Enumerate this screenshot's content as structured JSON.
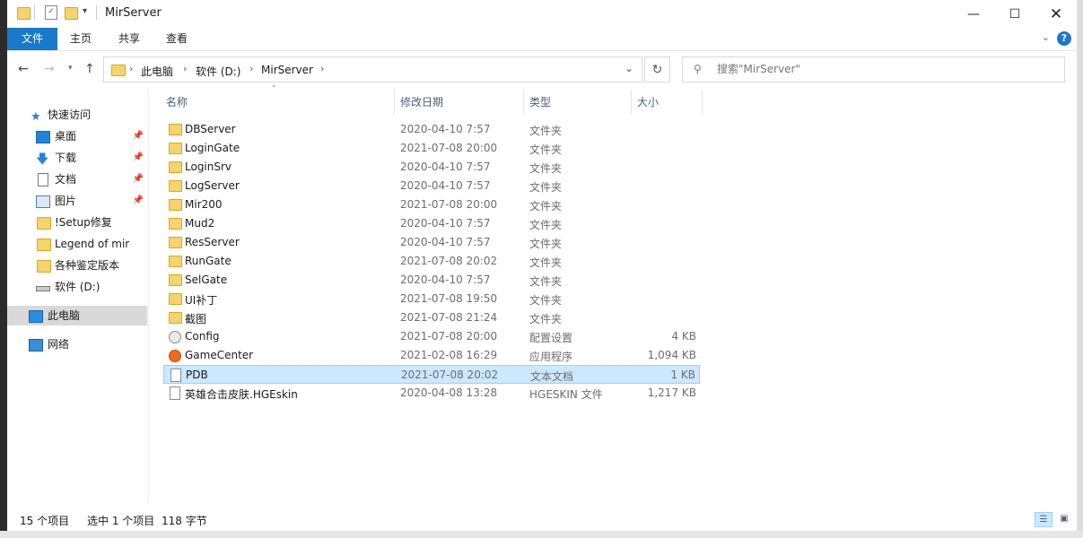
{
  "window": {
    "title": "MirServer"
  },
  "ribbon": {
    "tabs": [
      "文件",
      "主页",
      "共享",
      "查看"
    ],
    "help": "?"
  },
  "nav": {
    "address": [
      "此电脑",
      "软件 (D:)",
      "MirServer"
    ],
    "search_placeholder": "搜索\"MirServer\""
  },
  "sidebar": {
    "items": [
      {
        "label": "快速访问",
        "icon": "star-icon"
      },
      {
        "label": "桌面",
        "icon": "desktop-icon",
        "pinned": true
      },
      {
        "label": "下载",
        "icon": "download-icon",
        "pinned": true
      },
      {
        "label": "文档",
        "icon": "document-icon",
        "pinned": true
      },
      {
        "label": "图片",
        "icon": "picture-icon",
        "pinned": true
      },
      {
        "label": "!Setup修复",
        "icon": "folder-icon"
      },
      {
        "label": "Legend of mir",
        "icon": "folder-icon"
      },
      {
        "label": "各种鉴定版本",
        "icon": "folder-icon"
      },
      {
        "label": "软件 (D:)",
        "icon": "drive-icon"
      },
      {
        "label": "此电脑",
        "icon": "computer-icon"
      },
      {
        "label": "网络",
        "icon": "network-icon"
      }
    ]
  },
  "columns": {
    "name": "名称",
    "date": "修改日期",
    "type": "类型",
    "size": "大小"
  },
  "files": [
    {
      "name": "DBServer",
      "date": "2020-04-10 7:57",
      "type": "文件夹",
      "size": "",
      "icon": "folder-icon"
    },
    {
      "name": "LoginGate",
      "date": "2021-07-08 20:00",
      "type": "文件夹",
      "size": "",
      "icon": "folder-icon"
    },
    {
      "name": "LoginSrv",
      "date": "2020-04-10 7:57",
      "type": "文件夹",
      "size": "",
      "icon": "folder-icon"
    },
    {
      "name": "LogServer",
      "date": "2020-04-10 7:57",
      "type": "文件夹",
      "size": "",
      "icon": "folder-icon"
    },
    {
      "name": "Mir200",
      "date": "2021-07-08 20:00",
      "type": "文件夹",
      "size": "",
      "icon": "folder-icon"
    },
    {
      "name": "Mud2",
      "date": "2020-04-10 7:57",
      "type": "文件夹",
      "size": "",
      "icon": "folder-icon"
    },
    {
      "name": "ResServer",
      "date": "2020-04-10 7:57",
      "type": "文件夹",
      "size": "",
      "icon": "folder-icon"
    },
    {
      "name": "RunGate",
      "date": "2021-07-08 20:02",
      "type": "文件夹",
      "size": "",
      "icon": "folder-icon"
    },
    {
      "name": "SelGate",
      "date": "2020-04-10 7:57",
      "type": "文件夹",
      "size": "",
      "icon": "folder-icon"
    },
    {
      "name": "UI补丁",
      "date": "2021-07-08 19:50",
      "type": "文件夹",
      "size": "",
      "icon": "folder-icon"
    },
    {
      "name": "截图",
      "date": "2021-07-08 21:24",
      "type": "文件夹",
      "size": "",
      "icon": "folder-icon"
    },
    {
      "name": "Config",
      "date": "2021-07-08 20:00",
      "type": "配置设置",
      "size": "4 KB",
      "icon": "config-icon"
    },
    {
      "name": "GameCenter",
      "date": "2021-02-08 16:29",
      "type": "应用程序",
      "size": "1,094 KB",
      "icon": "app-icon"
    },
    {
      "name": "PDB",
      "date": "2021-07-08 20:02",
      "type": "文本文档",
      "size": "1 KB",
      "icon": "text-file-icon",
      "selected": true
    },
    {
      "name": "英雄合击皮肤.HGEskin",
      "date": "2020-04-08 13:28",
      "type": "HGESKIN 文件",
      "size": "1,217 KB",
      "icon": "file-icon"
    }
  ],
  "status": {
    "count": "15 个项目",
    "selected": "选中 1 个项目",
    "size": "118 字节"
  },
  "colors": {
    "accent": "#1979ca",
    "selection": "#cce8ff",
    "folder": "#f7d36b"
  }
}
